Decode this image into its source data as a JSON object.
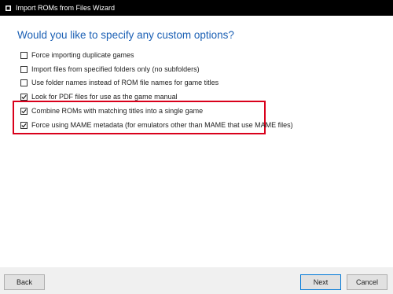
{
  "window": {
    "title": "Import ROMs from Files Wizard"
  },
  "main": {
    "heading": "Would you like to specify any custom options?",
    "options": [
      {
        "label": "Force importing duplicate games",
        "checked": false
      },
      {
        "label": "Import files from specified folders only (no subfolders)",
        "checked": false
      },
      {
        "label": "Use folder names instead of ROM file names for game titles",
        "checked": false
      },
      {
        "label": "Look for PDF files for use as the game manual",
        "checked": true
      },
      {
        "label": "Combine ROMs with matching titles into a single game",
        "checked": true
      },
      {
        "label": "Force using MAME metadata (for emulators other than MAME that use MAME files)",
        "checked": true
      }
    ]
  },
  "footer": {
    "back_label": "Back",
    "next_label": "Next",
    "cancel_label": "Cancel"
  },
  "colors": {
    "heading": "#1a5fb4",
    "highlight": "#d9001b",
    "titlebar": "#000000"
  }
}
